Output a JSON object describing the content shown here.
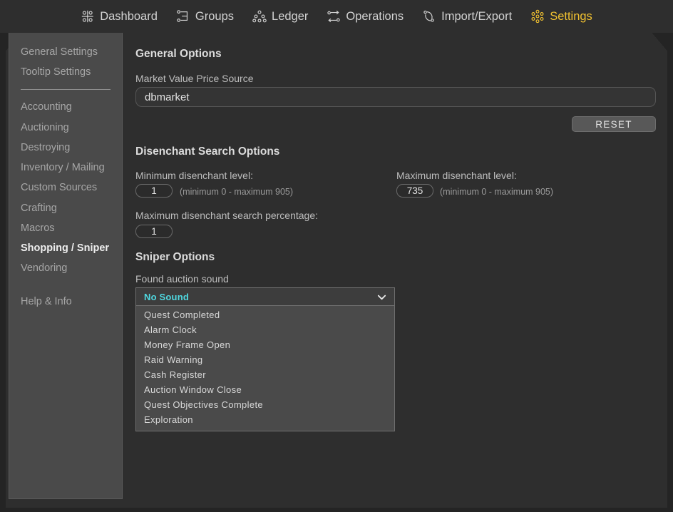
{
  "nav": {
    "items": [
      {
        "label": "Dashboard",
        "icon": "dashboard-icon",
        "active": false
      },
      {
        "label": "Groups",
        "icon": "groups-icon",
        "active": false
      },
      {
        "label": "Ledger",
        "icon": "ledger-icon",
        "active": false
      },
      {
        "label": "Operations",
        "icon": "operations-icon",
        "active": false
      },
      {
        "label": "Import/Export",
        "icon": "import-export-icon",
        "active": false
      },
      {
        "label": "Settings",
        "icon": "settings-icon",
        "active": true
      }
    ],
    "active_color": "#f2c230",
    "inactive_color": "#d2d2d2"
  },
  "sidebar": {
    "items": [
      {
        "label": "General Settings",
        "selected": false
      },
      {
        "label": "Tooltip Settings",
        "selected": false
      },
      {
        "label": "Accounting",
        "selected": false
      },
      {
        "label": "Auctioning",
        "selected": false
      },
      {
        "label": "Destroying",
        "selected": false
      },
      {
        "label": "Inventory / Mailing",
        "selected": false
      },
      {
        "label": "Custom Sources",
        "selected": false
      },
      {
        "label": "Crafting",
        "selected": false
      },
      {
        "label": "Macros",
        "selected": false
      },
      {
        "label": "Shopping / Sniper",
        "selected": true
      },
      {
        "label": "Vendoring",
        "selected": false
      },
      {
        "label": "Help & Info",
        "selected": false
      }
    ]
  },
  "general_options": {
    "title": "General Options",
    "price_source_label": "Market Value Price Source",
    "price_source_value": "dbmarket",
    "price_source_placeholder": "dbmarket",
    "reset_label": "RESET"
  },
  "disenchant_options": {
    "title": "Disenchant Search Options",
    "min_level_label": "Minimum disenchant level:",
    "min_level_value": "1",
    "min_level_hint": "(minimum 0 - maximum 905)",
    "max_level_label": "Maximum disenchant level:",
    "max_level_value": "735",
    "max_level_hint": "(minimum 0 - maximum 905)",
    "max_percentage_label": "Maximum disenchant search percentage:",
    "max_percentage_value": "1"
  },
  "sniper_options": {
    "title": "Sniper Options",
    "sound_label": "Found auction sound",
    "sound_selected": "No Sound",
    "sound_selected_color": "#4fd8e0",
    "sound_options": [
      "Quest Completed",
      "Alarm Clock",
      "Money Frame Open",
      "Raid Warning",
      "Cash Register",
      "Auction Window Close",
      "Quest Objectives Complete",
      "Exploration"
    ]
  }
}
